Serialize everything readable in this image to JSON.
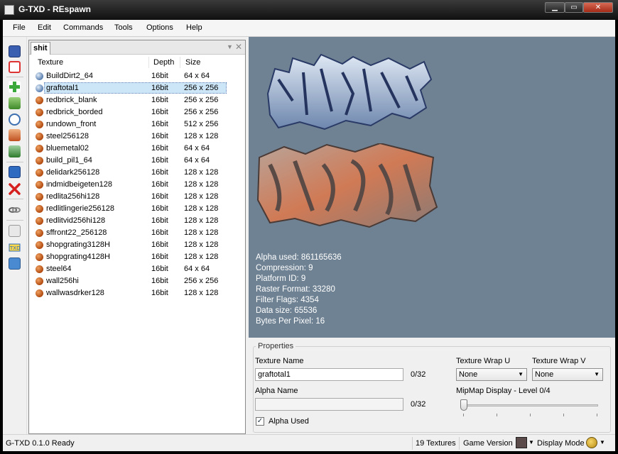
{
  "window": {
    "title": "G-TXD - REspawn"
  },
  "menu": [
    "File",
    "Edit",
    "Commands",
    "Tools",
    "Options",
    "Help"
  ],
  "toolbar_icons": [
    "save-icon",
    "close-file-icon",
    "add-icon",
    "import-icon",
    "timer-icon",
    "export-icon",
    "replace-icon",
    "convert-icon",
    "delete-icon",
    "link-icon",
    "list-icon",
    "txd-icon",
    "image-properties-icon"
  ],
  "panel": {
    "tab": "shit",
    "columns": {
      "name": "Texture",
      "depth": "Depth",
      "size": "Size"
    },
    "selected_index": 1,
    "rows": [
      {
        "name": "BuildDirt2_64",
        "depth": "16bit",
        "size": "64 x 64",
        "icon": "blue-ball-icon"
      },
      {
        "name": "graftotal1",
        "depth": "16bit",
        "size": "256 x 256",
        "icon": "blue-ball-icon"
      },
      {
        "name": "redbrick_blank",
        "depth": "16bit",
        "size": "256 x 256",
        "icon": "orange-ball-icon"
      },
      {
        "name": "redbrick_borded",
        "depth": "16bit",
        "size": "256 x 256",
        "icon": "orange-ball-icon"
      },
      {
        "name": "rundown_front",
        "depth": "16bit",
        "size": "512 x 256",
        "icon": "orange-ball-icon"
      },
      {
        "name": "steel256128",
        "depth": "16bit",
        "size": "128 x 128",
        "icon": "orange-ball-icon"
      },
      {
        "name": "bluemetal02",
        "depth": "16bit",
        "size": "64 x 64",
        "icon": "orange-ball-icon"
      },
      {
        "name": "build_pil1_64",
        "depth": "16bit",
        "size": "64 x 64",
        "icon": "orange-ball-icon"
      },
      {
        "name": "delidark256128",
        "depth": "16bit",
        "size": "128 x 128",
        "icon": "orange-ball-icon"
      },
      {
        "name": "indmidbeigeten128",
        "depth": "16bit",
        "size": "128 x 128",
        "icon": "orange-ball-icon"
      },
      {
        "name": "redlita256hi128",
        "depth": "16bit",
        "size": "128 x 128",
        "icon": "orange-ball-icon"
      },
      {
        "name": "redlitlingerie256128",
        "depth": "16bit",
        "size": "128 x 128",
        "icon": "orange-ball-icon"
      },
      {
        "name": "redlitvid256hi128",
        "depth": "16bit",
        "size": "128 x 128",
        "icon": "orange-ball-icon"
      },
      {
        "name": "sffront22_256128",
        "depth": "16bit",
        "size": "128 x 128",
        "icon": "orange-ball-icon"
      },
      {
        "name": "shopgrating3128H",
        "depth": "16bit",
        "size": "128 x 128",
        "icon": "orange-ball-icon"
      },
      {
        "name": "shopgrating4128H",
        "depth": "16bit",
        "size": "128 x 128",
        "icon": "orange-ball-icon"
      },
      {
        "name": "steel64",
        "depth": "16bit",
        "size": "64 x 64",
        "icon": "orange-ball-icon"
      },
      {
        "name": "wall256hi",
        "depth": "16bit",
        "size": "256 x 256",
        "icon": "orange-ball-icon"
      },
      {
        "name": "wallwasdrker128",
        "depth": "16bit",
        "size": "128 x 128",
        "icon": "orange-ball-icon"
      }
    ]
  },
  "preview": {
    "background": "#6f8293",
    "info": [
      "Alpha used: 861165636",
      "Compression: 9",
      "Platform ID: 9",
      "Raster Format: 33280",
      "Filter Flags: 4354",
      "Data size: 65536",
      "Bytes Per Pixel: 16"
    ]
  },
  "properties": {
    "title": "Properties",
    "texture_name_label": "Texture Name",
    "texture_name_value": "graftotal1",
    "texture_name_count": "0/32",
    "alpha_name_label": "Alpha Name",
    "alpha_name_value": "",
    "alpha_name_count": "0/32",
    "wrap_u_label": "Texture Wrap U",
    "wrap_u_value": "None",
    "wrap_v_label": "Texture Wrap V",
    "wrap_v_value": "None",
    "mipmap_label": "MipMap Display - Level 0/4",
    "mipmap_level": 0,
    "mipmap_max": 4,
    "alpha_used_label": "Alpha Used",
    "alpha_used_checked": true
  },
  "status": {
    "ready": "G-TXD 0.1.0 Ready",
    "texture_count": "19 Textures",
    "game_version_label": "Game Version",
    "display_mode_label": "Display Mode"
  }
}
